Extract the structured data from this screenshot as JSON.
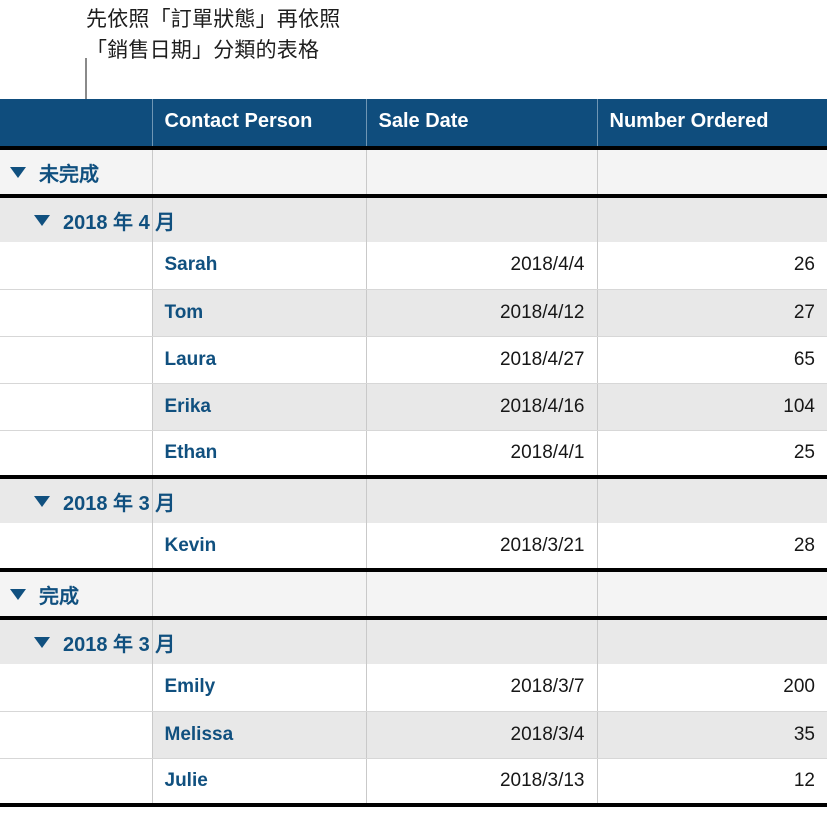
{
  "callout": {
    "text": "先依照「訂單狀態」再依照\n「銷售日期」分類的表格",
    "leader_color": "#8a8a8a"
  },
  "table": {
    "accent_header_bg": "#0f4d7d",
    "accent_text": "#10507f",
    "alt_row_bg": "#e8e8e8",
    "group_row_bg": "#f4f4f4",
    "subgroup_row_bg": "#e9e9e9",
    "columns": [
      {
        "key": "rowhdr",
        "label": ""
      },
      {
        "key": "name",
        "label": "Contact Person"
      },
      {
        "key": "date",
        "label": "Sale Date"
      },
      {
        "key": "num",
        "label": "Number Ordered"
      }
    ],
    "disclosure_glyph": "triangle-down",
    "rows": [
      {
        "type": "group",
        "label": "未完成"
      },
      {
        "type": "subgroup",
        "label": "2018 年 4 月"
      },
      {
        "type": "data",
        "name": "Sarah",
        "date": "2018/4/4",
        "num": "26"
      },
      {
        "type": "data",
        "name": "Tom",
        "date": "2018/4/12",
        "num": "27"
      },
      {
        "type": "data",
        "name": "Laura",
        "date": "2018/4/27",
        "num": "65"
      },
      {
        "type": "data",
        "name": "Erika",
        "date": "2018/4/16",
        "num": "104"
      },
      {
        "type": "data",
        "name": "Ethan",
        "date": "2018/4/1",
        "num": "25"
      },
      {
        "type": "subgroup",
        "label": "2018 年 3 月"
      },
      {
        "type": "data",
        "name": "Kevin",
        "date": "2018/3/21",
        "num": "28"
      },
      {
        "type": "group",
        "label": "完成"
      },
      {
        "type": "subgroup",
        "label": "2018 年 3 月"
      },
      {
        "type": "data",
        "name": "Emily",
        "date": "2018/3/7",
        "num": "200"
      },
      {
        "type": "data",
        "name": "Melissa",
        "date": "2018/3/4",
        "num": "35"
      },
      {
        "type": "data",
        "name": "Julie",
        "date": "2018/3/13",
        "num": "12"
      }
    ]
  }
}
